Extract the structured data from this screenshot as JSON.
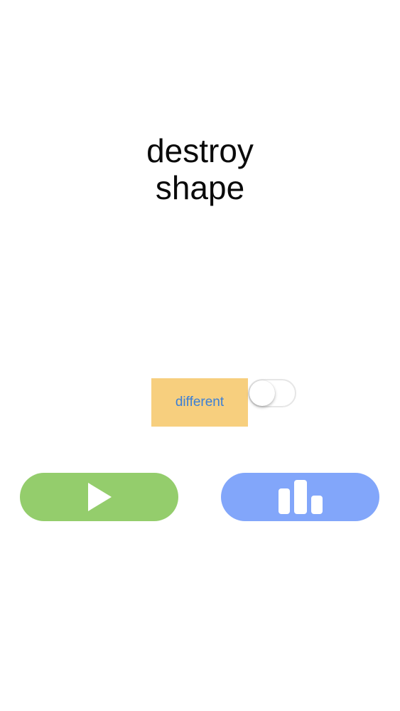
{
  "title": {
    "line1": "destroy",
    "line2": "shape"
  },
  "mode": {
    "label": "different",
    "toggle_on": false
  },
  "buttons": {
    "play_icon": "play-icon",
    "stats_icon": "bar-chart-icon"
  },
  "colors": {
    "mode_button_bg": "#f7cf7e",
    "mode_button_text": "#3b7fd6",
    "play_button_bg": "#94cd6c",
    "stats_button_bg": "#82a6fa",
    "icon_fill": "#ffffff"
  }
}
